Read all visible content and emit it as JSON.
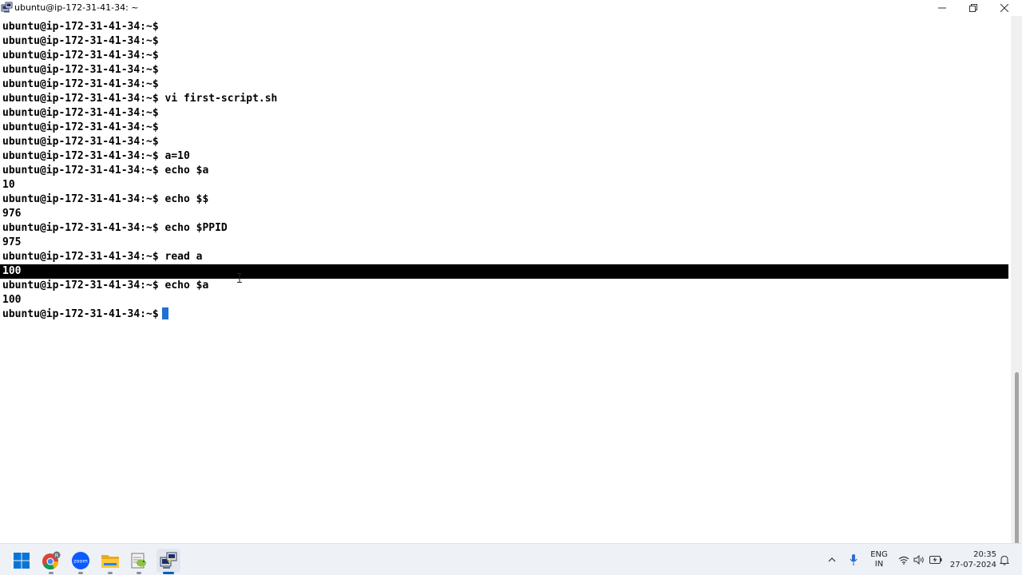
{
  "window": {
    "title": "ubuntu@ip-172-31-41-34: ~",
    "icons": {
      "app": "putty-icon",
      "minimize": "minimize-icon",
      "restore": "restore-icon",
      "close": "close-icon"
    }
  },
  "terminal": {
    "lines": [
      "ubuntu@ip-172-31-41-34:~$",
      "ubuntu@ip-172-31-41-34:~$",
      "ubuntu@ip-172-31-41-34:~$",
      "ubuntu@ip-172-31-41-34:~$",
      "ubuntu@ip-172-31-41-34:~$",
      "ubuntu@ip-172-31-41-34:~$ vi first-script.sh",
      "ubuntu@ip-172-31-41-34:~$",
      "ubuntu@ip-172-31-41-34:~$",
      "ubuntu@ip-172-31-41-34:~$",
      "ubuntu@ip-172-31-41-34:~$ a=10",
      "ubuntu@ip-172-31-41-34:~$ echo $a",
      "10",
      "ubuntu@ip-172-31-41-34:~$ echo $$",
      "976",
      "ubuntu@ip-172-31-41-34:~$ echo $PPID",
      "975",
      "ubuntu@ip-172-31-41-34:~$ read a",
      "100",
      "ubuntu@ip-172-31-41-34:~$ echo $a",
      "100",
      "ubuntu@ip-172-31-41-34:~$"
    ],
    "highlighted_line_index": 17,
    "cursor_color": "#1f6fd6",
    "selection_background": "#000000"
  },
  "taskbar": {
    "items": [
      {
        "name": "windows-start-icon",
        "active": false
      },
      {
        "name": "chrome-icon",
        "active": false,
        "badge": "R"
      },
      {
        "name": "zoom-icon",
        "active": false,
        "label": "zoom"
      },
      {
        "name": "file-explorer-icon",
        "active": false
      },
      {
        "name": "notepad-plus-plus-icon",
        "active": false
      },
      {
        "name": "putty-icon",
        "active": true
      }
    ],
    "tray": {
      "chevron_icon": "chevron-up-icon",
      "mic_icon": "microphone-icon",
      "language_line1": "ENG",
      "language_line2": "IN",
      "wifi_icon": "wifi-icon",
      "volume_icon": "volume-icon",
      "battery_icon": "battery-charging-icon",
      "time": "20:35",
      "date": "27-07-2024",
      "notification_icon": "bell-icon"
    }
  }
}
